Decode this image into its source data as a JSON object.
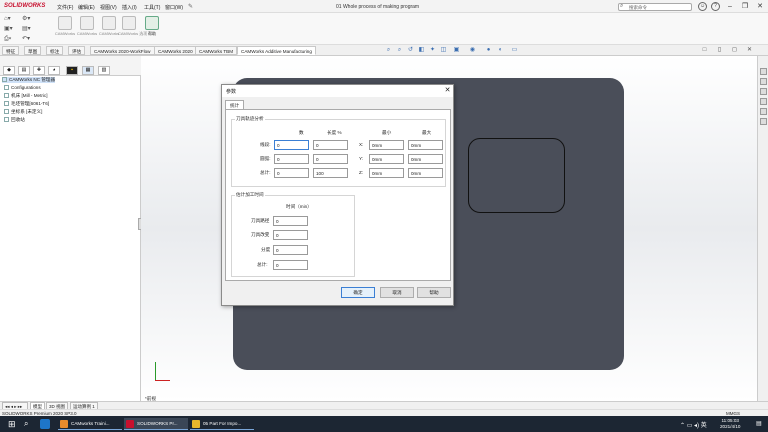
{
  "app": {
    "logo_text": "SOLIDWORKS",
    "document_title": "01 Whole process of making program"
  },
  "menu": [
    "文件(F)",
    "编辑(E)",
    "视图(V)",
    "插入(I)",
    "工具(T)",
    "窗口(W)"
  ],
  "search": {
    "placeholder": "搜索命令"
  },
  "ribbon": {
    "help_label": "帮助",
    "disabled_labels": [
      "CAMWorks",
      "CAMWorks",
      "CAMWorks",
      "CAMWorks 选项"
    ]
  },
  "tabs": [
    "特征",
    "草图",
    "标注",
    "评估",
    "CAMWorks 2020-WorkFlow",
    "CAMWorks 2020",
    "CAMWorks TBM",
    "CAMWorks Additive Manufacturing"
  ],
  "tree": {
    "root": "CAMWorks NC 管理器",
    "items": [
      "Configurations",
      "机床 [Mill - Metric]",
      "毛坯管理[6061-T6]",
      "坐标系 [未定义]",
      "回收站"
    ]
  },
  "viewport": {
    "view_label": "*前视"
  },
  "bottom_tabs": [
    "模型",
    "3D 视图",
    "运动算例 1"
  ],
  "status": {
    "text": "SOLIDWORKS Premium 2020 SP3.0",
    "units": "MMGS"
  },
  "taskbar": {
    "apps": [
      "CAMworks Traini...",
      "SOLIDWORKS Pr...",
      "05 Part For Impo..."
    ],
    "time": "11:05:03",
    "date": "2021/4/10"
  },
  "dialog": {
    "title": "参数",
    "tab": "统计",
    "toolpath": {
      "group_title": "刀具轨迹分析",
      "col_count": "数",
      "col_length": "长度 %",
      "col_min": "最小",
      "col_max": "最大",
      "rows": [
        {
          "label": "线段:",
          "count": "0",
          "length": "0",
          "axis": "X:",
          "min": "0mm",
          "max": "0mm"
        },
        {
          "label": "圆弧:",
          "count": "0",
          "length": "0",
          "axis": "Y:",
          "min": "0mm",
          "max": "0mm"
        },
        {
          "label": "总计:",
          "count": "0",
          "length": "100",
          "axis": "Z:",
          "min": "0mm",
          "max": "0mm"
        }
      ]
    },
    "machining_time": {
      "group_title": "估计加工时间",
      "col_time": "时间（min）",
      "rows": [
        {
          "label": "刀具路径",
          "value": "0"
        },
        {
          "label": "刀具改变",
          "value": "0"
        },
        {
          "label": "分度",
          "value": "0"
        },
        {
          "label": "总计:",
          "value": "0"
        }
      ]
    },
    "buttons": {
      "ok": "确定",
      "cancel": "取消",
      "help": "帮助"
    }
  },
  "colors": {
    "part": "#4a4e59",
    "accent": "#3b7fd4",
    "brand": "#c8102e"
  }
}
